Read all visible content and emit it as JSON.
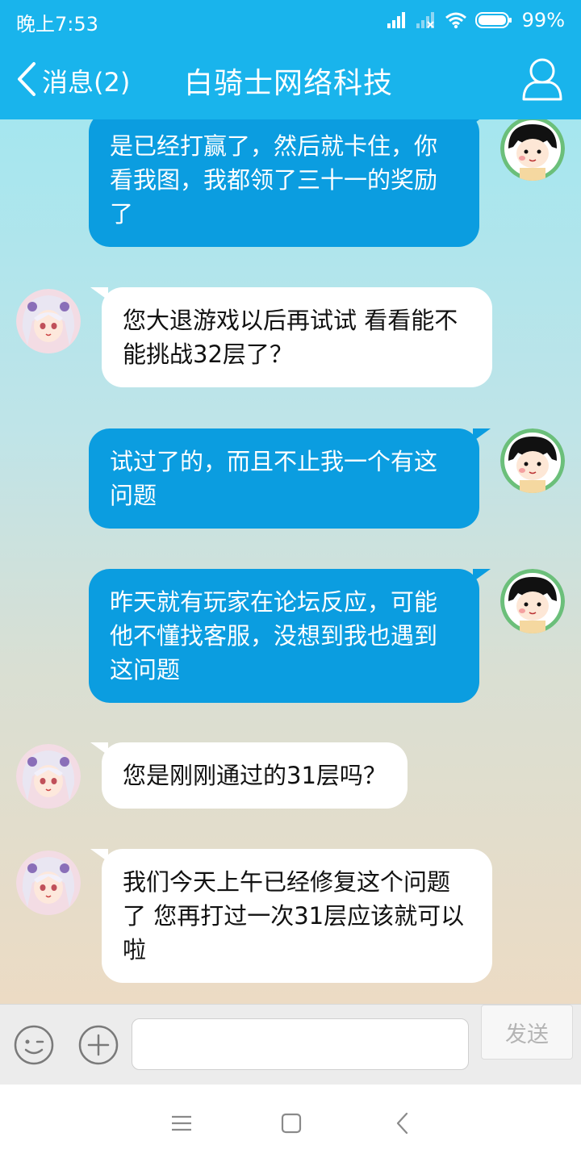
{
  "status": {
    "time": "晚上7:53",
    "battery": "99%"
  },
  "header": {
    "back_label": "消息(2)",
    "title": "白骑士网络科技"
  },
  "messages": [
    {
      "side": "out",
      "text": "是已经打赢了，然后就卡住，你看我图，我都领了三十一的奖励了"
    },
    {
      "side": "in",
      "text": "您大退游戏以后再试试 看看能不能挑战32层了？"
    },
    {
      "side": "out",
      "text": "试过了的，而且不止我一个有这问题"
    },
    {
      "side": "out",
      "text": "昨天就有玩家在论坛反应，可能他不懂找客服，没想到我也遇到这问题"
    },
    {
      "side": "in",
      "text": "您是刚刚通过的31层吗？"
    },
    {
      "side": "in",
      "text": "我们今天上午已经修复这个问题了 您再打过一次31层应该就可以啦"
    }
  ],
  "input": {
    "value": "",
    "placeholder": "",
    "send_label": "发送"
  },
  "icons": {
    "back": "chevron-left-icon",
    "profile": "person-icon",
    "emoji": "smiley-icon",
    "plus": "plus-icon",
    "nav_menu": "menu-icon",
    "nav_home": "square-icon",
    "nav_back": "back-chevron-icon"
  },
  "colors": {
    "header_bg": "#19b4ec",
    "outgoing_bubble": "#0b9de0",
    "incoming_bubble": "#ffffff"
  }
}
